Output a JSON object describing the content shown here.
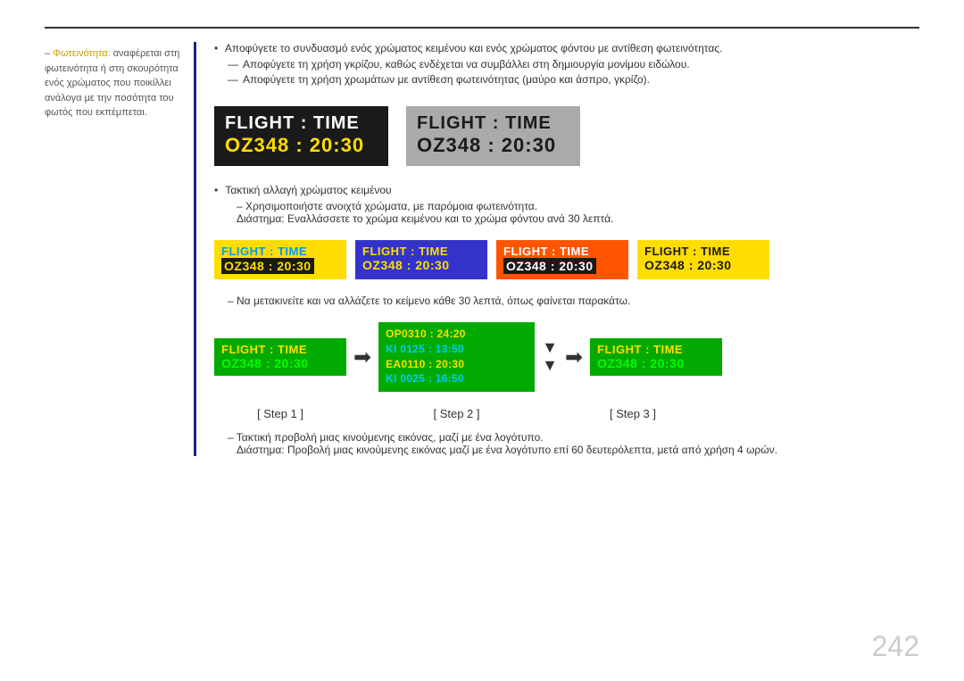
{
  "page": {
    "number": "242",
    "top_line": true
  },
  "sidebar": {
    "bullet": "–",
    "text_part1": "Φωτεινότητα:",
    "text_part2": " αναφέρεται στη φωτεινότητα ή στη σκουρότητα ενός χρώματος που ποικίλλει ανάλογα με την ποσότητα του φωτός που εκπέμπεται."
  },
  "main": {
    "bullets": [
      "Αποφύγετε το συνδυασμό ενός χρώματος κειμένου και ενός χρώματος φόντου με αντίθεση φωτεινότητας.",
      "Αποφύγετε τη χρήση γκρίζου, καθώς ενδέχεται να συμβάλλει στη δημιουργία μονίμου ειδώλου.",
      "Αποφύγετε τη χρήση χρωμάτων με αντίθεση φωτεινότητας (μαύρο και άσπρο, γκρίζο)."
    ],
    "flight_box_dark": {
      "title": "FLIGHT  :  TIME",
      "number": "OZ348  :  20:30"
    },
    "flight_box_gray": {
      "title": "FLIGHT  :  TIME",
      "number": "OZ348  :  20:30"
    },
    "section2_bullet": "Τακτική αλλαγή χρώματος κειμένου",
    "section2_sub1": "Χρησιμοποιήστε ανοιχτά χρώματα, με παρόμοια φωτεινότητα.",
    "section2_sub2": "Διάστημα: Εναλλάσσετε το χρώμα κειμένου και το χρώμα φόντου ανά 30 λεπτά.",
    "small_boxes": [
      {
        "title": "FLIGHT  :  TIME",
        "number": "OZ348  :  20:30",
        "variant": "yellow"
      },
      {
        "title": "FLIGHT  :  TIME",
        "number": "OZ348  :  20:30",
        "variant": "blue"
      },
      {
        "title": "FLIGHT  :  TIME",
        "number": "OZ348  :  20:30",
        "variant": "orange"
      },
      {
        "title": "FLIGHT  :  TIME",
        "number": "OZ348  :  20:30",
        "variant": "yellow2"
      }
    ],
    "section3_dash": "Να μετακινείτε και να αλλάζετε το κείμενο κάθε 30 λεπτά, όπως φαίνεται παρακάτω.",
    "steps": [
      {
        "label": "[ Step 1 ]"
      },
      {
        "label": "[ Step 2 ]"
      },
      {
        "label": "[ Step 3 ]"
      }
    ],
    "step1_box": {
      "title": "FLIGHT  :  TIME",
      "number": "OZ348  :  20:30"
    },
    "step2_box": {
      "lines": [
        "OP0310  :  24:20",
        "KI 0125  :  13:50",
        "EA0110  :  20:30",
        "KI 0025  :  16:50"
      ]
    },
    "step3_box": {
      "title": "FLIGHT  :  TIME",
      "number": "OZ348  :  20:30"
    },
    "section4_dash": "Τακτική προβολή μιας κινούμενης εικόνας, μαζί με ένα λογότυπο.",
    "section4_sub": "Διάστημα: Προβολή μιας κινούμενης εικόνας μαζί με ένα λογότυπο επί 60 δευτερόλεπτα, μετά από χρήση 4 ωρών."
  }
}
